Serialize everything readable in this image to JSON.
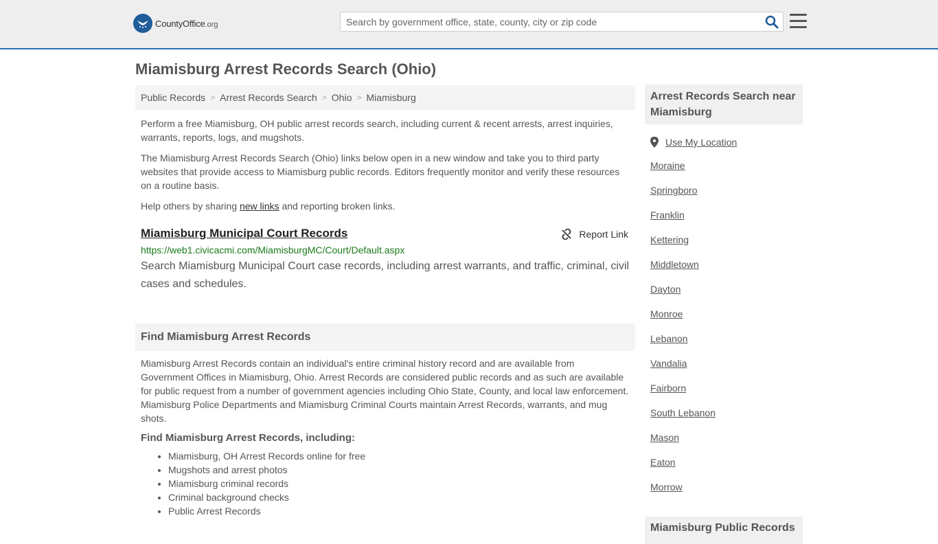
{
  "header": {
    "logo_county": "County",
    "logo_office": "Office",
    "logo_org": ".org",
    "search_placeholder": "Search by government office, state, county, city or zip code",
    "search_icon": "search-icon",
    "menu_icon": "hamburger-menu-icon"
  },
  "page": {
    "title": "Miamisburg Arrest Records Search (Ohio)"
  },
  "breadcrumb": [
    "Public Records",
    "Arrest Records Search",
    "Ohio",
    "Miamisburg"
  ],
  "intro": {
    "p1": "Perform a free Miamisburg, OH public arrest records search, including current & recent arrests, arrest inquiries, warrants, reports, logs, and mugshots.",
    "p2": "The Miamisburg Arrest Records Search (Ohio) links below open in a new window and take you to third party websites that provide access to Miamisburg public records. Editors frequently monitor and verify these resources on a routine basis.",
    "p3_before": "Help others by sharing ",
    "p3_link": "new links",
    "p3_after": " and reporting broken links."
  },
  "record": {
    "title": "Miamisburg Municipal Court Records",
    "report_label": "Report Link",
    "url": "https://web1.civicacmi.com/MiamisburgMC/Court/Default.aspx",
    "description": "Search Miamisburg Municipal Court case records, including arrest warrants, and traffic, criminal, civil cases and schedules."
  },
  "find": {
    "heading": "Find Miamisburg Arrest Records",
    "body": "Miamisburg Arrest Records contain an individual's entire criminal history record and are available from Government Offices in Miamisburg, Ohio. Arrest Records are considered public records and as such are available for public request from a number of government agencies including Ohio State, County, and local law enforcement. Miamisburg Police Departments and Miamisburg Criminal Courts maintain Arrest Records, warrants, and mug shots.",
    "subheading": "Find Miamisburg Arrest Records, including:",
    "items": [
      "Miamisburg, OH Arrest Records online for free",
      "Mugshots and arrest photos",
      "Miamisburg criminal records",
      "Criminal background checks",
      "Public Arrest Records"
    ]
  },
  "sidebar": {
    "heading": "Arrest Records Search near Miamisburg",
    "use_location": "Use My Location",
    "cities": [
      "Moraine",
      "Springboro",
      "Franklin",
      "Kettering",
      "Middletown",
      "Dayton",
      "Monroe",
      "Lebanon",
      "Vandalia",
      "Fairborn",
      "South Lebanon",
      "Mason",
      "Eaton",
      "Morrow"
    ],
    "heading2": "Miamisburg Public Records"
  }
}
